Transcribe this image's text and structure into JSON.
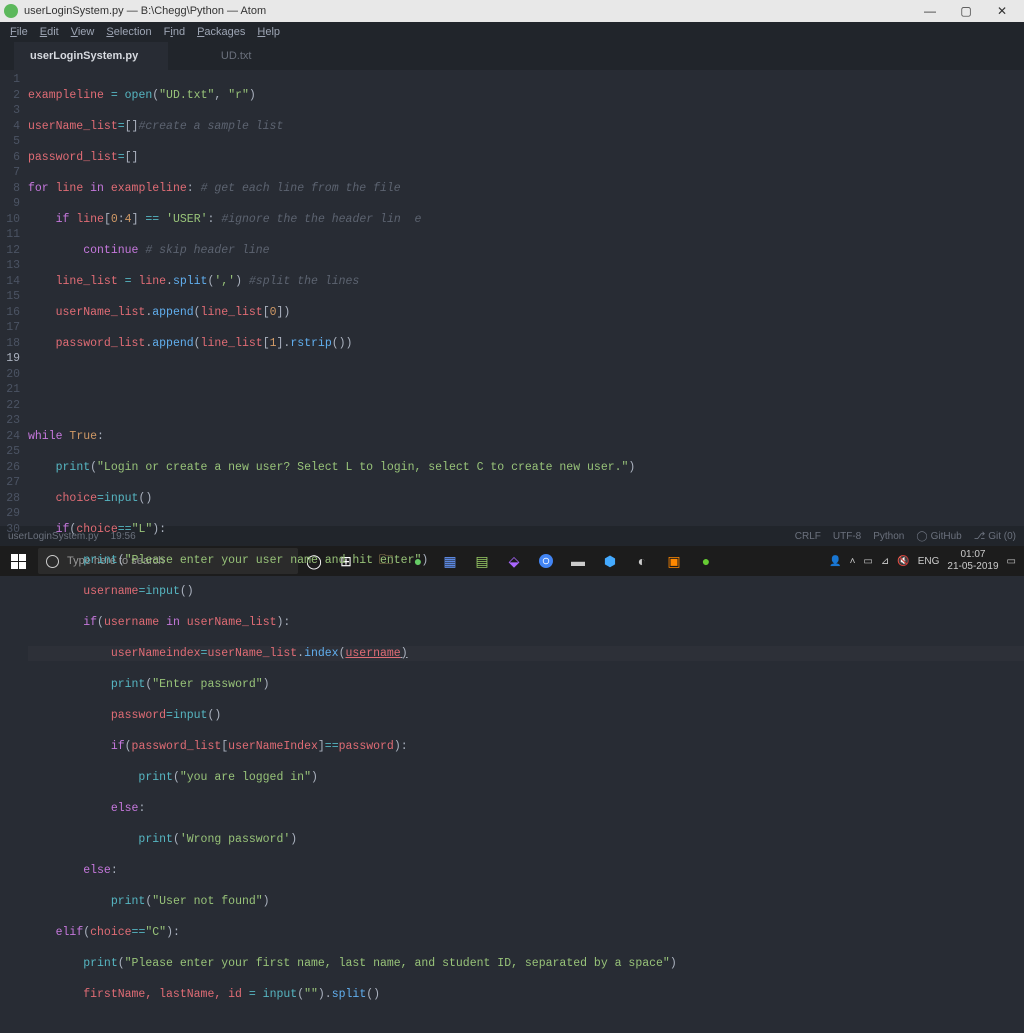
{
  "window": {
    "title": "userLoginSystem.py — B:\\Chegg\\Python — Atom",
    "min": "—",
    "max": "▢",
    "close": "✕"
  },
  "menu": {
    "file": "File",
    "edit": "Edit",
    "view": "View",
    "selection": "Selection",
    "find": "Find",
    "packages": "Packages",
    "help": "Help"
  },
  "tabs": {
    "active": "userLoginSystem.py",
    "other": "UD.txt"
  },
  "gutter": [
    "1",
    "2",
    "3",
    "4",
    "5",
    "6",
    "7",
    "8",
    "9",
    "10",
    "11",
    "12",
    "13",
    "14",
    "15",
    "16",
    "17",
    "18",
    "19",
    "20",
    "21",
    "22",
    "23",
    "24",
    "25",
    "26",
    "27",
    "28",
    "29",
    "30"
  ],
  "code": {
    "l1_a": "exampleline ",
    "l1_op": "= ",
    "l1_fn": "open",
    "l1_p1": "(",
    "l1_s1": "\"UD.txt\"",
    "l1_c": ", ",
    "l1_s2": "\"r\"",
    "l1_p2": ")",
    "l2_a": "userName_list",
    "l2_op": "=",
    "l2_b": "[]",
    "l2_cmt": "#create a sample list",
    "l3_a": "password_list",
    "l3_op": "=",
    "l3_b": "[]",
    "l4_k1": "for ",
    "l4_v": "line ",
    "l4_k2": "in ",
    "l4_e": "exampleline",
    "l4_c": ": ",
    "l4_cmt": "# get each line from the file",
    "l5_i": "    ",
    "l5_k": "if ",
    "l5_v": "line",
    "l5_sl": "[",
    "l5_n1": "0",
    "l5_co": ":",
    "l5_n2": "4",
    "l5_sr": "] ",
    "l5_eq": "== ",
    "l5_s": "'USER'",
    "l5_col": ": ",
    "l5_cmt": "#ignore the the header lin  e",
    "l6_i": "        ",
    "l6_k": "continue ",
    "l6_cmt": "# skip header line",
    "l7_i": "    ",
    "l7_a": "line_list ",
    "l7_op": "= ",
    "l7_v": "line",
    "l7_d": ".",
    "l7_fn": "split",
    "l7_p1": "(",
    "l7_s": "','",
    "l7_p2": ") ",
    "l7_cmt": "#split the lines",
    "l8_i": "    ",
    "l8_a": "userName_list",
    "l8_d": ".",
    "l8_fn": "append",
    "l8_p1": "(",
    "l8_v": "line_list",
    "l8_b1": "[",
    "l8_n": "0",
    "l8_b2": "])",
    "l9_i": "    ",
    "l9_a": "password_list",
    "l9_d": ".",
    "l9_fn": "append",
    "l9_p1": "(",
    "l9_v": "line_list",
    "l9_b1": "[",
    "l9_n": "1",
    "l9_b2": "].",
    "l9_fn2": "rstrip",
    "l9_p2": "())",
    "l12_k": "while ",
    "l12_t": "True",
    "l12_c": ":",
    "l13_i": "    ",
    "l13_fn": "print",
    "l13_p1": "(",
    "l13_s": "\"Login or create a new user? Select L to login, select C to create new user.\"",
    "l13_p2": ")",
    "l14_i": "    ",
    "l14_a": "choice",
    "l14_op": "=",
    "l14_fn": "input",
    "l14_p": "()",
    "l15_i": "    ",
    "l15_k": "if",
    "l15_p1": "(",
    "l15_v": "choice",
    "l15_eq": "==",
    "l15_s": "\"L\"",
    "l15_p2": "):",
    "l16_i": "        ",
    "l16_fn": "print",
    "l16_p1": "(",
    "l16_s": "\"Please enter your user name and hit enter\"",
    "l16_p2": ")",
    "l17_i": "        ",
    "l17_a": "username",
    "l17_op": "=",
    "l17_fn": "input",
    "l17_p": "()",
    "l18_i": "        ",
    "l18_k": "if",
    "l18_p1": "(",
    "l18_v1": "username ",
    "l18_in": "in ",
    "l18_v2": "userName_list",
    "l18_p2": "):",
    "l19_i": "            ",
    "l19_a": "userNameindex",
    "l19_op": "=",
    "l19_v": "userName_list",
    "l19_d": ".",
    "l19_fn": "index",
    "l19_p1": "(",
    "l19_arg": "username",
    "l19_p2": ")",
    "l20_i": "            ",
    "l20_fn": "print",
    "l20_p1": "(",
    "l20_s": "\"Enter password\"",
    "l20_p2": ")",
    "l21_i": "            ",
    "l21_a": "password",
    "l21_op": "=",
    "l21_fn": "input",
    "l21_p": "()",
    "l22_i": "            ",
    "l22_k": "if",
    "l22_p1": "(",
    "l22_v1": "password_list",
    "l22_b1": "[",
    "l22_v2": "userNameIndex",
    "l22_b2": "]",
    "l22_eq": "==",
    "l22_v3": "password",
    "l22_p2": "):",
    "l23_i": "                ",
    "l23_fn": "print",
    "l23_p1": "(",
    "l23_s": "\"you are logged in\"",
    "l23_p2": ")",
    "l24_i": "            ",
    "l24_k": "else",
    "l24_c": ":",
    "l25_i": "                ",
    "l25_fn": "print",
    "l25_p1": "(",
    "l25_s": "'Wrong password'",
    "l25_p2": ")",
    "l26_i": "        ",
    "l26_k": "else",
    "l26_c": ":",
    "l27_i": "            ",
    "l27_fn": "print",
    "l27_p1": "(",
    "l27_s": "\"User not found\"",
    "l27_p2": ")",
    "l28_i": "    ",
    "l28_k": "elif",
    "l28_p1": "(",
    "l28_v": "choice",
    "l28_eq": "==",
    "l28_s": "\"C\"",
    "l28_p2": "):",
    "l29_i": "        ",
    "l29_fn": "print",
    "l29_p1": "(",
    "l29_s": "\"Please enter your first name, last name, and student ID, separated by a space\"",
    "l29_p2": ")",
    "l30_i": "        ",
    "l30_a": "firstName, lastName, id ",
    "l30_op": "= ",
    "l30_fn": "input",
    "l30_p1": "(",
    "l30_s": "\"\"",
    "l30_p2": ").",
    "l30_fn2": "split",
    "l30_p3": "()"
  },
  "status": {
    "file": "userLoginSystem.py",
    "pos": "19:56",
    "eol": "CRLF",
    "enc": "UTF-8",
    "lang": "Python",
    "github": "GitHub",
    "git": "Git (0)"
  },
  "taskbar": {
    "search_placeholder": "Type here to search",
    "lang": "ENG",
    "time": "01:07",
    "date": "21-05-2019"
  }
}
